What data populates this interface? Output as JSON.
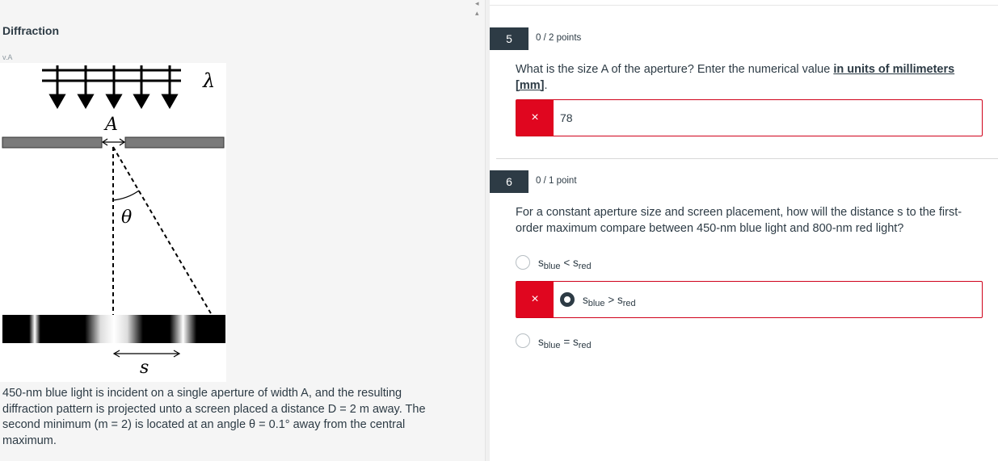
{
  "left": {
    "title": "Diffraction",
    "version": "v.A",
    "figure": {
      "lambda_label": "λ",
      "a_label": "A",
      "theta_label": "θ",
      "s_label": "s"
    },
    "description": "450-nm blue light is incident on a single aperture of width A, and the resulting diffraction pattern is projected unto a screen placed a distance D = 2 m away. The second minimum (m = 2) is located at an angle θ = 0.1° away from the central maximum."
  },
  "questions": [
    {
      "number": "5",
      "points": "0 / 2 points",
      "text_before": "What is the size A of the aperture? Enter the numerical value ",
      "text_link": "in units of millimeters [mm]",
      "text_after": ".",
      "answer": "78",
      "status_icon": "×"
    },
    {
      "number": "6",
      "points": "0 / 1 point",
      "text": "For a constant aperture size and screen placement, how will the distance s to the first-order maximum compare between 450-nm blue light and 800-nm red light?",
      "status_icon": "×",
      "options": [
        {
          "s1": "s",
          "sub1": "blue",
          "op": "<",
          "s2": "s",
          "sub2": "red",
          "selected": false
        },
        {
          "s1": "s",
          "sub1": "blue",
          "op": ">",
          "s2": "s",
          "sub2": "red",
          "selected": true
        },
        {
          "s1": "s",
          "sub1": "blue",
          "op": "=",
          "s2": "s",
          "sub2": "red",
          "selected": false
        }
      ]
    }
  ],
  "colors": {
    "incorrect": "#e0061f",
    "badge": "#2d3b45",
    "text": "#2d3b45"
  }
}
